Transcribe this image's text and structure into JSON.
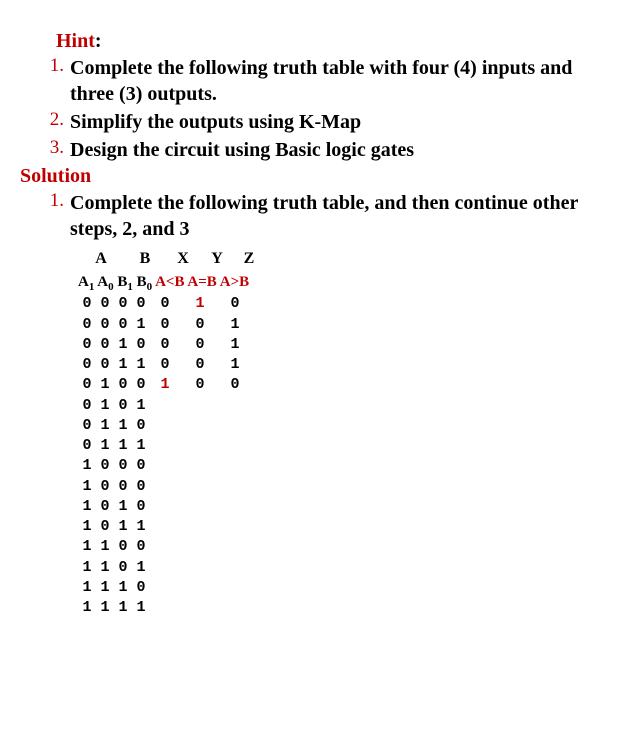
{
  "hint": {
    "label": "Hint",
    "colon": ":",
    "items": [
      {
        "num": "1.",
        "text": "Complete the following truth table with four (4) inputs and three (3) outputs."
      },
      {
        "num": "2.",
        "text": "Simplify the outputs using K-Map"
      },
      {
        "num": "3.",
        "text": "Design the circuit using Basic logic gates"
      }
    ]
  },
  "solution": {
    "label": "Solution",
    "items": [
      {
        "num": "1.",
        "text": "Complete the following truth table, and then continue other steps, 2, and 3"
      }
    ]
  },
  "table": {
    "group_headers": {
      "A": "A",
      "B": "B",
      "X": "X",
      "Y": "Y",
      "Z": "Z"
    },
    "col_headers": {
      "A1": "A",
      "A1sub": "1",
      "A0": "A",
      "A0sub": "0",
      "B1": "B",
      "B1sub": "1",
      "B0": "B",
      "B0sub": "0",
      "X": "A<B",
      "Y": "A=B",
      "Z": "A>B"
    },
    "rows": [
      {
        "a1": "0",
        "a0": "0",
        "b1": "0",
        "b0": "0",
        "x": "0",
        "y": "1",
        "z": "0",
        "y_red": true
      },
      {
        "a1": "0",
        "a0": "0",
        "b1": "0",
        "b0": "1",
        "x": "0",
        "y": "0",
        "z": "1"
      },
      {
        "a1": "0",
        "a0": "0",
        "b1": "1",
        "b0": "0",
        "x": "0",
        "y": "0",
        "z": "1"
      },
      {
        "a1": "0",
        "a0": "0",
        "b1": "1",
        "b0": "1",
        "x": "0",
        "y": "0",
        "z": "1"
      },
      {
        "a1": "0",
        "a0": "1",
        "b1": "0",
        "b0": "0",
        "x": "1",
        "y": "0",
        "z": "0",
        "x_red": true
      },
      {
        "a1": "0",
        "a0": "1",
        "b1": "0",
        "b0": "1"
      },
      {
        "a1": "0",
        "a0": "1",
        "b1": "1",
        "b0": "0"
      },
      {
        "a1": "0",
        "a0": "1",
        "b1": "1",
        "b0": "1"
      },
      {
        "a1": "1",
        "a0": "0",
        "b1": "0",
        "b0": "0"
      },
      {
        "a1": "1",
        "a0": "0",
        "b1": "0",
        "b0": "0"
      },
      {
        "a1": "1",
        "a0": "0",
        "b1": "1",
        "b0": "0"
      },
      {
        "a1": "1",
        "a0": "0",
        "b1": "1",
        "b0": "1"
      },
      {
        "a1": "1",
        "a0": "1",
        "b1": "0",
        "b0": "0"
      },
      {
        "a1": "1",
        "a0": "1",
        "b1": "0",
        "b0": "1"
      },
      {
        "a1": "1",
        "a0": "1",
        "b1": "1",
        "b0": "0"
      },
      {
        "a1": "1",
        "a0": "1",
        "b1": "1",
        "b0": "1"
      }
    ]
  }
}
